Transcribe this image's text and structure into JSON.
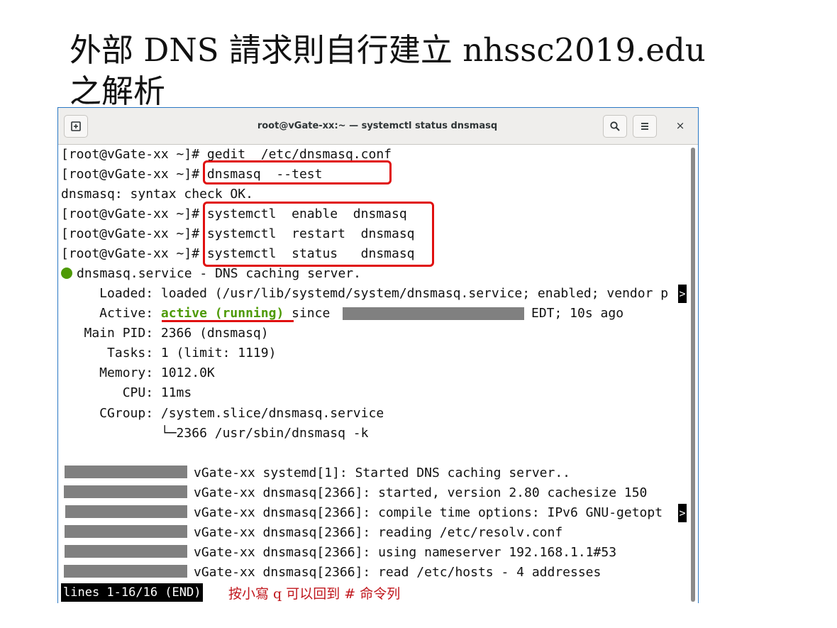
{
  "slide": {
    "title_line1": "外部 DNS 請求則自行建立 nhssc2019.edu",
    "title_line2": "之解析"
  },
  "window": {
    "title": "root@vGate-xx:~ — systemctl status dnsmasq",
    "new_tab_icon": "new-tab-icon",
    "search_icon": "search-icon",
    "menu_icon": "hamburger-menu-icon",
    "close_label": "×"
  },
  "terminal": {
    "lines": [
      "[root@vGate-xx ~]# gedit  /etc/dnsmasq.conf",
      "[root@vGate-xx ~]# dnsmasq  --test",
      "dnsmasq: syntax check OK.",
      "[root@vGate-xx ~]# systemctl  enable  dnsmasq",
      "[root@vGate-xx ~]# systemctl  restart  dnsmasq",
      "[root@vGate-xx ~]# systemctl  status   dnsmasq"
    ],
    "service_line": "dnsmasq.service - DNS caching server.",
    "loaded": "     Loaded: loaded (/usr/lib/systemd/system/dnsmasq.service; enabled; vendor p",
    "active_prefix": "     Active: ",
    "active_state": "active (running)",
    "active_since": " since ",
    "active_suffix": "EDT; 10s ago",
    "main_pid": "   Main PID: 2366 (dnsmasq)",
    "tasks": "      Tasks: 1 (limit: 1119)",
    "memory": "     Memory: 1012.0K",
    "cpu": "        CPU: 11ms",
    "cgroup": "     CGroup: /system.slice/dnsmasq.service",
    "cgroup_child": "             └─2366 /usr/sbin/dnsmasq -k",
    "log_lines": [
      "vGate-xx systemd[1]: Started DNS caching server..",
      "vGate-xx dnsmasq[2366]: started, version 2.80 cachesize 150",
      "vGate-xx dnsmasq[2366]: compile time options: IPv6 GNU-getopt ",
      "vGate-xx dnsmasq[2366]: reading /etc/resolv.conf",
      "vGate-xx dnsmasq[2366]: using nameserver 192.168.1.1#53",
      "vGate-xx dnsmasq[2366]: read /etc/hosts - 4 addresses"
    ],
    "truncation_marker": ">",
    "pager_status": "lines 1-16/16 (END)",
    "hint_note": "按小寫 q 可以回到 # 命令列"
  },
  "colors": {
    "active_green": "#4e9a06",
    "highlight_red": "#e01010",
    "note_red": "#c0161c"
  }
}
